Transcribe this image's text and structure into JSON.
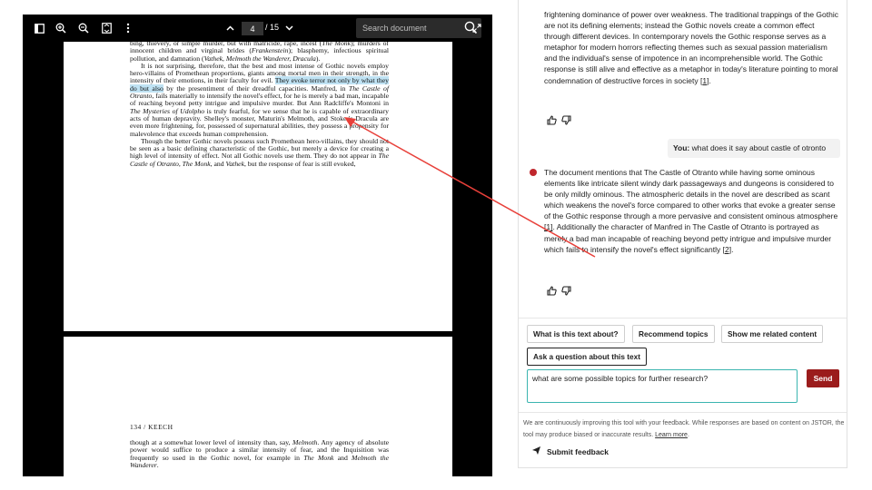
{
  "toolbar": {
    "page_current": "4",
    "page_total": "/ 15",
    "search_placeholder": "Search document"
  },
  "pdf": {
    "page1_paragraphs": [
      {
        "segments": [
          {
            "t": "bing, thievery, or simple murder, but with matricide, rape, incest ("
          },
          {
            "t": "The Monk",
            "i": true
          },
          {
            "t": "); murders of innocent children and virginal brides ("
          },
          {
            "t": "Frankenstein",
            "i": true
          },
          {
            "t": "); blasphemy, infectious spiritual pollution, and damnation ("
          },
          {
            "t": "Vathek, Melmoth the Wanderer, Dracula",
            "i": true
          },
          {
            "t": ")."
          }
        ],
        "indent": false
      },
      {
        "segments": [
          {
            "t": "It is not surprising, therefore, that the best and most intense of Gothic novels employ hero-villains of Promethean proportions, giants among mortal men in their strength, in the intensity of their emotions, in their faculty for evil. "
          },
          {
            "t": "They evoke terror not only by what they do but also",
            "hl": true
          },
          {
            "t": " by the presentiment of their dreadful capacities. Manfred, in "
          },
          {
            "t": "The Castle of Otranto",
            "i": true
          },
          {
            "t": ", fails materially to intensify the novel's effect, for he is merely a bad man, incapable of reaching beyond petty intrigue and impulsive murder. But Ann Radcliffe's Montoni in "
          },
          {
            "t": "The Mysteries of Udolpho",
            "i": true
          },
          {
            "t": " is truly fearful, for we sense that he is capable of extraordinary acts of human depravity. Shelley's monster, Maturin's Melmoth, and Stoker's Dracula are even more frightening, for, possessed of supernatural abilities, they possess a propensity for malevolence that exceeds human comprehension."
          }
        ],
        "indent": true
      },
      {
        "segments": [
          {
            "t": "Though the better Gothic novels possess such Promethean hero-villains, they should not be seen as a basic defining characteristic of the Gothic, but merely a device for creating a high level of intensity of effect. Not all Gothic novels use them. They do not appear in "
          },
          {
            "t": "The Castle of Otranto, The Monk",
            "i": true
          },
          {
            "t": ", and "
          },
          {
            "t": "Vathek",
            "i": true
          },
          {
            "t": ", but the response of fear is still evoked,"
          }
        ],
        "indent": true
      }
    ],
    "page2_header": "134  /  KEECH",
    "page2_paragraphs": [
      {
        "segments": [
          {
            "t": "though at a somewhat lower level of intensity than, say, "
          },
          {
            "t": "Melmoth",
            "i": true
          },
          {
            "t": ". Any agency of absolute power would suffice to produce a similar intensity of fear, and the Inquisition was frequently so used in the Gothic novel, for example in "
          },
          {
            "t": "The Monk",
            "i": true
          },
          {
            "t": " and "
          },
          {
            "t": "Melmoth the Wanderer",
            "i": true
          },
          {
            "t": "."
          }
        ],
        "indent": false
      }
    ]
  },
  "chat": {
    "msg1_text": "frightening dominance of power over weakness. The traditional trappings of the Gothic are not its defining elements; instead the Gothic novels create a common effect through different devices. In contemporary novels the Gothic response serves as a metaphor for modern horrors reflecting themes such as sexual passion materialism and the individual's sense of impotence in an incomprehensible world. The Gothic response is still alive and effective as a metaphor in today's literature pointing to moral condemnation of destructive forces in society",
    "msg1_cite": "[1]",
    "user_label": "You:",
    "user_question": "what does it say about castle of otronto",
    "msg2_part1": "The document mentions that The Castle of Otranto while having some ominous elements like intricate silent windy dark passageways and dungeons is considered to be only mildly ominous. The atmospheric details in the novel are described as scant which weakens the novel's force compared to other works that evoke a greater sense of the Gothic response through a more pervasive and consistent ominous atmosphere",
    "msg2_cite1": "[1]",
    "msg2_part2": ". Additionally the character of Manfred in The Castle of Otranto is portrayed as merely a bad man incapable of reaching beyond petty intrigue and impulsive murder which fails to intensify the novel's effect significantly",
    "msg2_cite2": "[2]",
    "msg2_end": "."
  },
  "actions": {
    "chip_about": "What is this text about?",
    "chip_topics": "Recommend topics",
    "chip_related": "Show me related content",
    "chip_ask": "Ask a question about this text",
    "question_value": "what are some possible topics for further research?",
    "send_label": "Send"
  },
  "footer": {
    "disclaimer": "We are continuously improving this tool with your feedback. While responses are based on content on JSTOR, the tool may produce biased or inaccurate results.",
    "learn_more": "Learn more",
    "disclaimer_end": ".",
    "feedback_label": "Submit feedback"
  },
  "colors": {
    "accent": "#9b1c1c",
    "highlight": "#bfe2f3",
    "input_border": "#3bb5b0",
    "annotation_arrow": "#e8403a"
  }
}
